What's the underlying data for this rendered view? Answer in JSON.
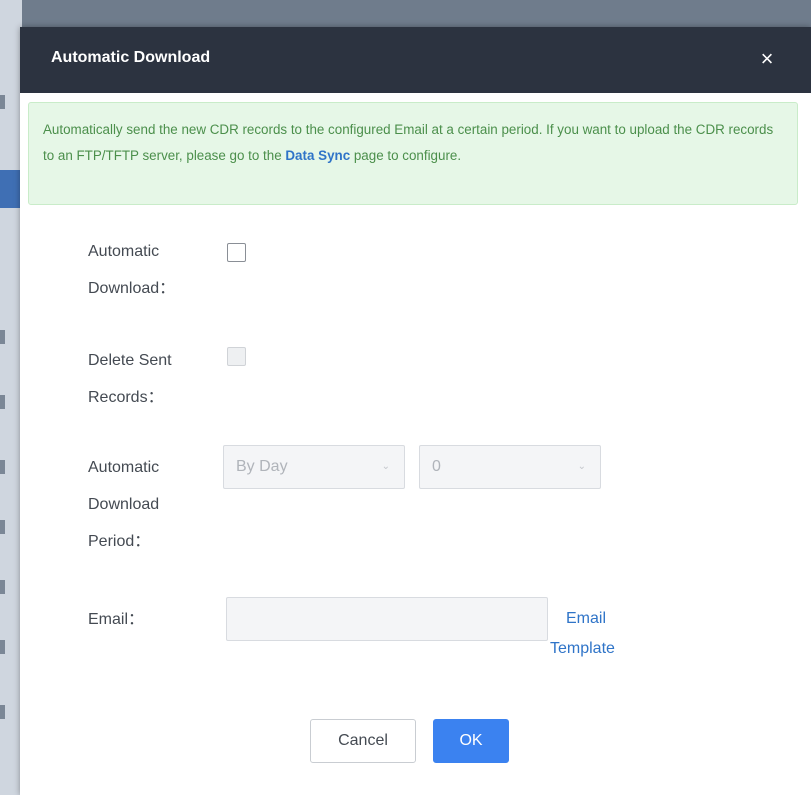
{
  "dialog": {
    "title": "Automatic Download",
    "close_glyph": "×"
  },
  "notice": {
    "text_before": "Automatically send the new CDR records to the configured Email at a certain period. If you want to upload the CDR records to an FTP/TFTP server, please go to the ",
    "link": "Data Sync",
    "text_after": " page to configure."
  },
  "fields": {
    "auto_download": {
      "label_line1": "Automatic",
      "label_line2": "Download：",
      "checked": false
    },
    "delete_sent": {
      "label_line1": "Delete Sent",
      "label_line2": "Records：",
      "checked": false,
      "disabled": true
    },
    "period": {
      "label_line1": "Automatic",
      "label_line2": "Download",
      "label_line3": "Period：",
      "frequency_value": "By Day",
      "time_value": "0"
    },
    "email": {
      "label": "Email：",
      "value": "",
      "template_link_line1": "Email",
      "template_link_line2": "Template"
    }
  },
  "buttons": {
    "cancel": "Cancel",
    "ok": "OK"
  },
  "colors": {
    "header": "#2c3340",
    "notice_bg": "#e6f7e7",
    "notice_text": "#4b8f4b",
    "link": "#2f74c8",
    "primary": "#3b82f0"
  }
}
